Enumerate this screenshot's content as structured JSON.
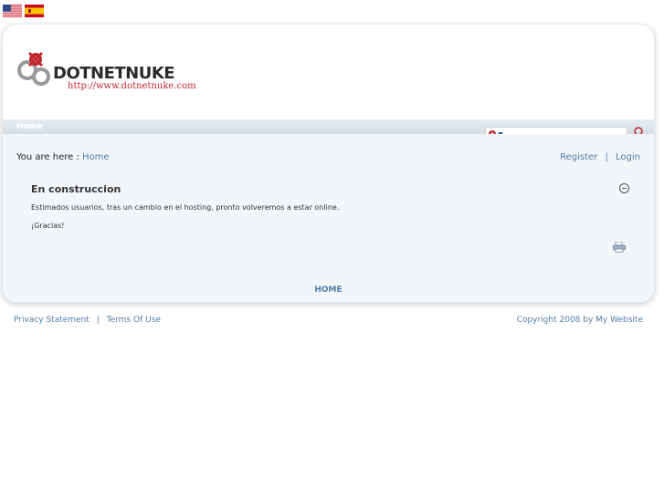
{
  "languages": [
    {
      "name": "english",
      "icon": "us-flag-icon"
    },
    {
      "name": "espanol",
      "icon": "spain-flag-icon"
    }
  ],
  "logo": {
    "word": "DOTNETNUKE",
    "url": "http://www.dotnetnuke.com",
    "accent": "#c0282d"
  },
  "menu": {
    "home_label": "Home"
  },
  "search": {
    "value": "",
    "placeholder": ""
  },
  "breadcrumb": {
    "prefix": "You are here :",
    "current": "Home"
  },
  "user": {
    "register": "Register",
    "separator": "|",
    "login": "Login"
  },
  "module": {
    "title": "En construccion",
    "text": "Estimados usuarios, tras un cambio en el hosting, pronto volveremos a estar online.",
    "thanks": "¡Gracias!"
  },
  "footer": {
    "home": "HOME",
    "privacy": "Privacy Statement",
    "separator": "|",
    "terms": "Terms Of Use",
    "copyright": "Copyright 2008 by My Website"
  },
  "colors": {
    "link": "#4f7ea6",
    "border": "#d2dde6",
    "content_bg": "#f3f6f9"
  }
}
